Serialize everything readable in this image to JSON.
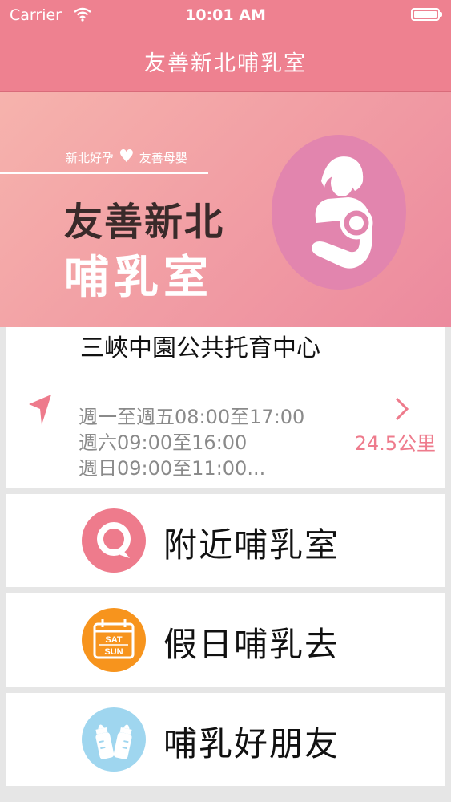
{
  "status_bar": {
    "carrier": "Carrier",
    "time": "10:01 AM"
  },
  "nav_bar": {
    "title": "友善新北哺乳室"
  },
  "banner": {
    "tagline_left": "新北好孕",
    "tagline_right": "友善母嬰",
    "title_line1": "友善新北",
    "title_line2": "哺乳室"
  },
  "station": {
    "name": "三峽中園公共托育中心",
    "hours": [
      "週一至週五08:00至17:00",
      "週六09:00至16:00",
      "週日09:00至11:00..."
    ],
    "distance": "24.5公里"
  },
  "menu": {
    "nearby_label": "附近哺乳室",
    "holiday_label": "假日哺乳去",
    "holiday_icon_top": "SAT",
    "holiday_icon_bottom": "SUN",
    "friends_label": "哺乳好朋友"
  },
  "colors": {
    "header": "#ee8190",
    "accent": "#ee7b8c",
    "logo_circle": "#e285ae",
    "holiday_icon": "#f7941d",
    "friends_icon": "#9fd6ef"
  }
}
